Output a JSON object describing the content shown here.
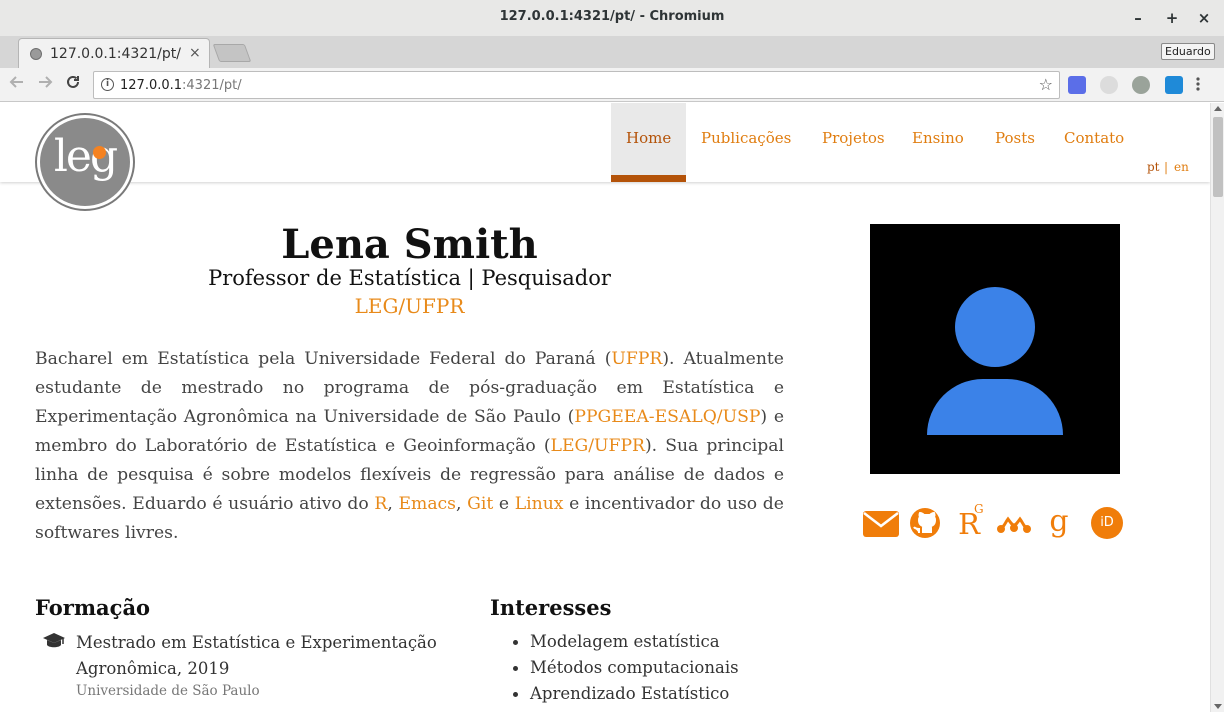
{
  "window": {
    "title": "127.0.0.1:4321/pt/ - Chromium",
    "controls": {
      "minimize": "–",
      "maximize": "+",
      "close": "×"
    }
  },
  "tab": {
    "title": "127.0.0.1:4321/pt/",
    "close": "×"
  },
  "profile": "Eduardo",
  "address_bar": {
    "host": "127.0.0.1",
    "rest": ":4321/pt/"
  },
  "icons": {
    "back": "arrow-left-icon",
    "forward": "arrow-right-icon",
    "reload": "reload-icon",
    "info": "info-icon",
    "bookmark": "star-icon"
  },
  "site": {
    "logo_text": "leg",
    "nav": [
      "Home",
      "Publicações",
      "Projetos",
      "Ensino",
      "Posts",
      "Contato"
    ],
    "active_nav": "Home",
    "lang": {
      "pt": "pt",
      "sep": "|",
      "en": "en"
    }
  },
  "profile_card": {
    "name": "Lena Smith",
    "role": "Professor de Estatística | Pesquisador",
    "org": "LEG/UFPR"
  },
  "bio": {
    "p1": "Bacharel em Estatística pela Universidade Federal do Paraná (",
    "l1": "UFPR",
    "p2": "). Atualmente estudante de mestrado no programa de pós-graduação em Estatística e Experimentação Agronômica na Universidade de São Paulo (",
    "l2": "PPGEEA-ESALQ/USP",
    "p3": ") e membro do Laboratório de Estatística e Geoinformação (",
    "l3": "LEG/UFPR",
    "p4": "). Sua principal linha de pesquisa é sobre modelos flexíveis de regressão para análise de dados e extensões. Eduardo é usuário ativo do ",
    "l4": "R",
    "p5": ", ",
    "l5": "Emacs",
    "p6": ", ",
    "l6": "Git",
    "p7": " e ",
    "l7": "Linux",
    "p8": " e incentivador do uso de softwares livres."
  },
  "social": {
    "researchgate_label": "R",
    "researchgate_sup": "G",
    "googlescholar_label": "g",
    "orcid_label": "iD",
    "icon_names": [
      "envelope-icon",
      "github-icon",
      "researchgate-icon",
      "mendeley-icon",
      "google-scholar-icon",
      "orcid-icon"
    ]
  },
  "education": {
    "heading": "Formação",
    "degree": "Mestrado em Estatística e Experimentação Agronômica, 2019",
    "institution": "Universidade de São Paulo"
  },
  "interests": {
    "heading": "Interesses",
    "items": [
      "Modelagem estatística",
      "Métodos computacionais",
      "Aprendizado Estatístico"
    ]
  },
  "colors": {
    "accent": "#e88a1a",
    "active": "#b45309",
    "avatar_bg": "#000000",
    "avatar_fg": "#3b82e8"
  }
}
